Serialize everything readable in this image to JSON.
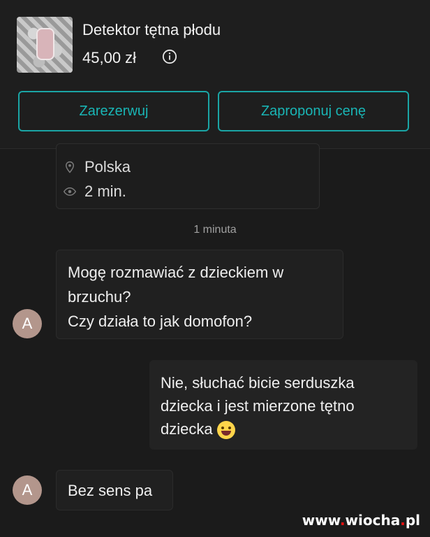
{
  "listing": {
    "title": "Detektor tętna płodu",
    "price": "45,00 zł",
    "buttons": {
      "reserve": "Zarezerwuj",
      "offer": "Zaproponuj cenę"
    },
    "details": {
      "location": "Polska",
      "views": "2 min."
    }
  },
  "chat": {
    "timestamp": "1 minuta",
    "messages": [
      {
        "from": "A",
        "lines": [
          "Mogę rozmawiać z dzieckiem w",
          "brzuchu?",
          "Czy działa to jak domofon?"
        ]
      },
      {
        "from": "me",
        "lines": [
          "Nie, słuchać bicie serduszka",
          "dziecka i jest mierzone tętno",
          "dziecka"
        ]
      },
      {
        "from": "A",
        "lines": [
          "Bez sens pa"
        ]
      }
    ]
  },
  "watermark": {
    "prefix": "www",
    "name": "wiocha",
    "suffix": "pl"
  },
  "colors": {
    "accent": "#19b5b5",
    "avatar": "#b3968c",
    "background": "#1b1b1b"
  },
  "icons": {
    "info": "info-icon",
    "location": "location-pin-icon",
    "views": "eye-icon",
    "emoji": "grinning-sweat-emoji-icon"
  }
}
